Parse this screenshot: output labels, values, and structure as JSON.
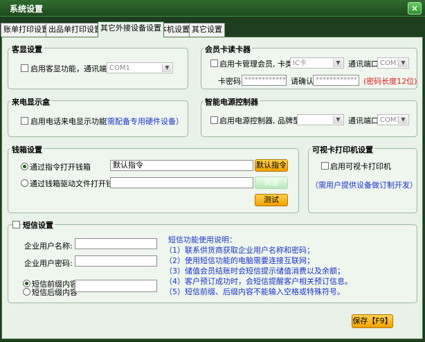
{
  "window": {
    "title": "系统设置",
    "close": "×"
  },
  "tabs": [
    "账单打印设置",
    "出品单打印设置",
    "其它外接设备设置",
    "本机设置",
    "其它设置"
  ],
  "customer_display": {
    "title": "客显设置",
    "enable_label": "启用客显功能，通讯端口",
    "port_value": "COM1"
  },
  "member_card": {
    "title": "会员卡读卡器",
    "enable_label": "启用卡管理会员, 卡类型",
    "card_type_value": "IC卡",
    "port_label": "通讯端口",
    "port_value": "COM1",
    "pwd_label": "卡密码",
    "pwd_value": "************",
    "confirm_label": "请确认",
    "confirm_value": "************",
    "pwd_hint": "(密码长度12位)"
  },
  "caller_id": {
    "title": "来电显示盒",
    "enable_label": "启用电话来电显示功能",
    "hint": "（需配备专用硬件设备）"
  },
  "power_ctrl": {
    "title": "智能电源控制器",
    "enable_label": "启用电源控制器, 品牌型号",
    "brand_value": "",
    "port_label": "通讯端口",
    "port_value": "COM1"
  },
  "cash_drawer": {
    "title": "钱箱设置",
    "opt1_label": "通过指令打开钱箱",
    "opt1_value": "默认指令",
    "default_btn": "默认指令",
    "opt2_label": "通过钱箱驱动文件打开钱箱",
    "opt2_value": "",
    "browse_btn": "浏览",
    "test_btn": "测试"
  },
  "visual_card": {
    "title": "可视卡打印机设置",
    "enable_label": "启用可视卡打印机",
    "hint": "（需用户提供设备做订制开发）"
  },
  "sms": {
    "title": "短信设置",
    "user_label": "企业用户名称:",
    "user_value": "",
    "pwd_label": "企业用户密码:",
    "pwd_value": "",
    "prefix_label": "短信前缀内容",
    "suffix_label": "短信后缀内容",
    "content_value": "",
    "help_title": "短信功能使用说明：",
    "help_items": [
      "（1）联系供货商获取企业用户名称和密码；",
      "（2）使用短信功能的电脑需要连接互联网；",
      "（3）储值会员结账时会短信提示储值消费以及余额；",
      "（4）客户预订成功时，会短信提醒客户相关预订信息。",
      "（5）短信前缀、后缀内容不能输入空格或特殊符号。"
    ]
  },
  "save_btn": "保存【F9】"
}
